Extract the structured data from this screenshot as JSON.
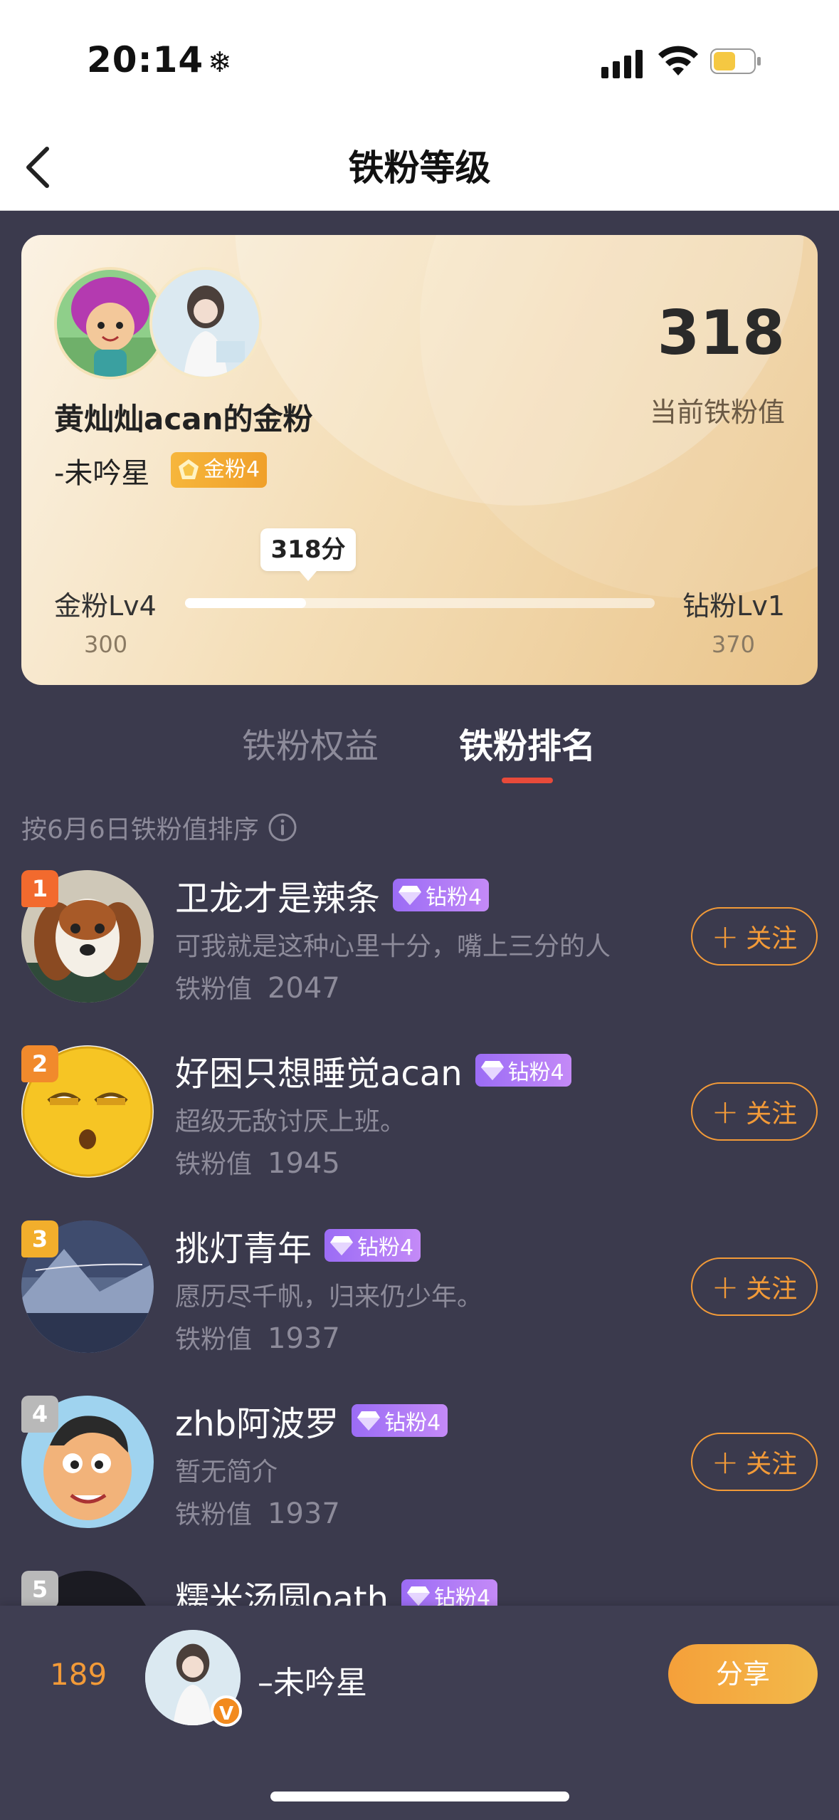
{
  "status_bar": {
    "time": "20:14",
    "time_icon": "❄"
  },
  "nav": {
    "title": "铁粉等级"
  },
  "card": {
    "fan_title": "黄灿灿acan的金粉",
    "username": "-未吟星",
    "badge": "金粉4",
    "score": "318",
    "score_label": "当前铁粉值",
    "progress_tooltip": "318分",
    "level_left": "金粉Lv4",
    "level_left_value": "300",
    "level_right": "钻粉Lv1",
    "level_right_value": "370",
    "progress_fraction": 0.257
  },
  "tabs": [
    {
      "label": "铁粉权益"
    },
    {
      "label": "铁粉排名"
    }
  ],
  "sort_hint": "按6月6日铁粉值排序",
  "score_prefix": "铁粉值",
  "follow_label": "关注",
  "ranking": [
    {
      "rank": "1",
      "name": "卫龙才是辣条",
      "badge": "钻粉4",
      "bio": "可我就是这种心里十分，嘴上三分的人",
      "score": "2047"
    },
    {
      "rank": "2",
      "name": "好困只想睡觉acan",
      "badge": "钻粉4",
      "bio": "超级无敌讨厌上班。",
      "score": "1945"
    },
    {
      "rank": "3",
      "name": "挑灯青年",
      "badge": "钻粉4",
      "bio": "愿历尽千帆，归来仍少年。",
      "score": "1937"
    },
    {
      "rank": "4",
      "name": "zhb阿波罗",
      "badge": "钻粉4",
      "bio": "暂无简介",
      "score": "1937"
    },
    {
      "rank": "5",
      "name": "糯米汤圆oath",
      "badge": "钻粉4",
      "bio": "",
      "score": ""
    }
  ],
  "bottom_bar": {
    "my_rank": "189",
    "my_name": "–未吟星",
    "v_badge": "V",
    "share_label": "分享"
  },
  "colors": {
    "accent": "#f29a38",
    "tab_indicator": "#e84a3a",
    "background": "#3b3a4d",
    "diamond_badge": "#a874f6",
    "gold_badge": "#f3ab33"
  }
}
